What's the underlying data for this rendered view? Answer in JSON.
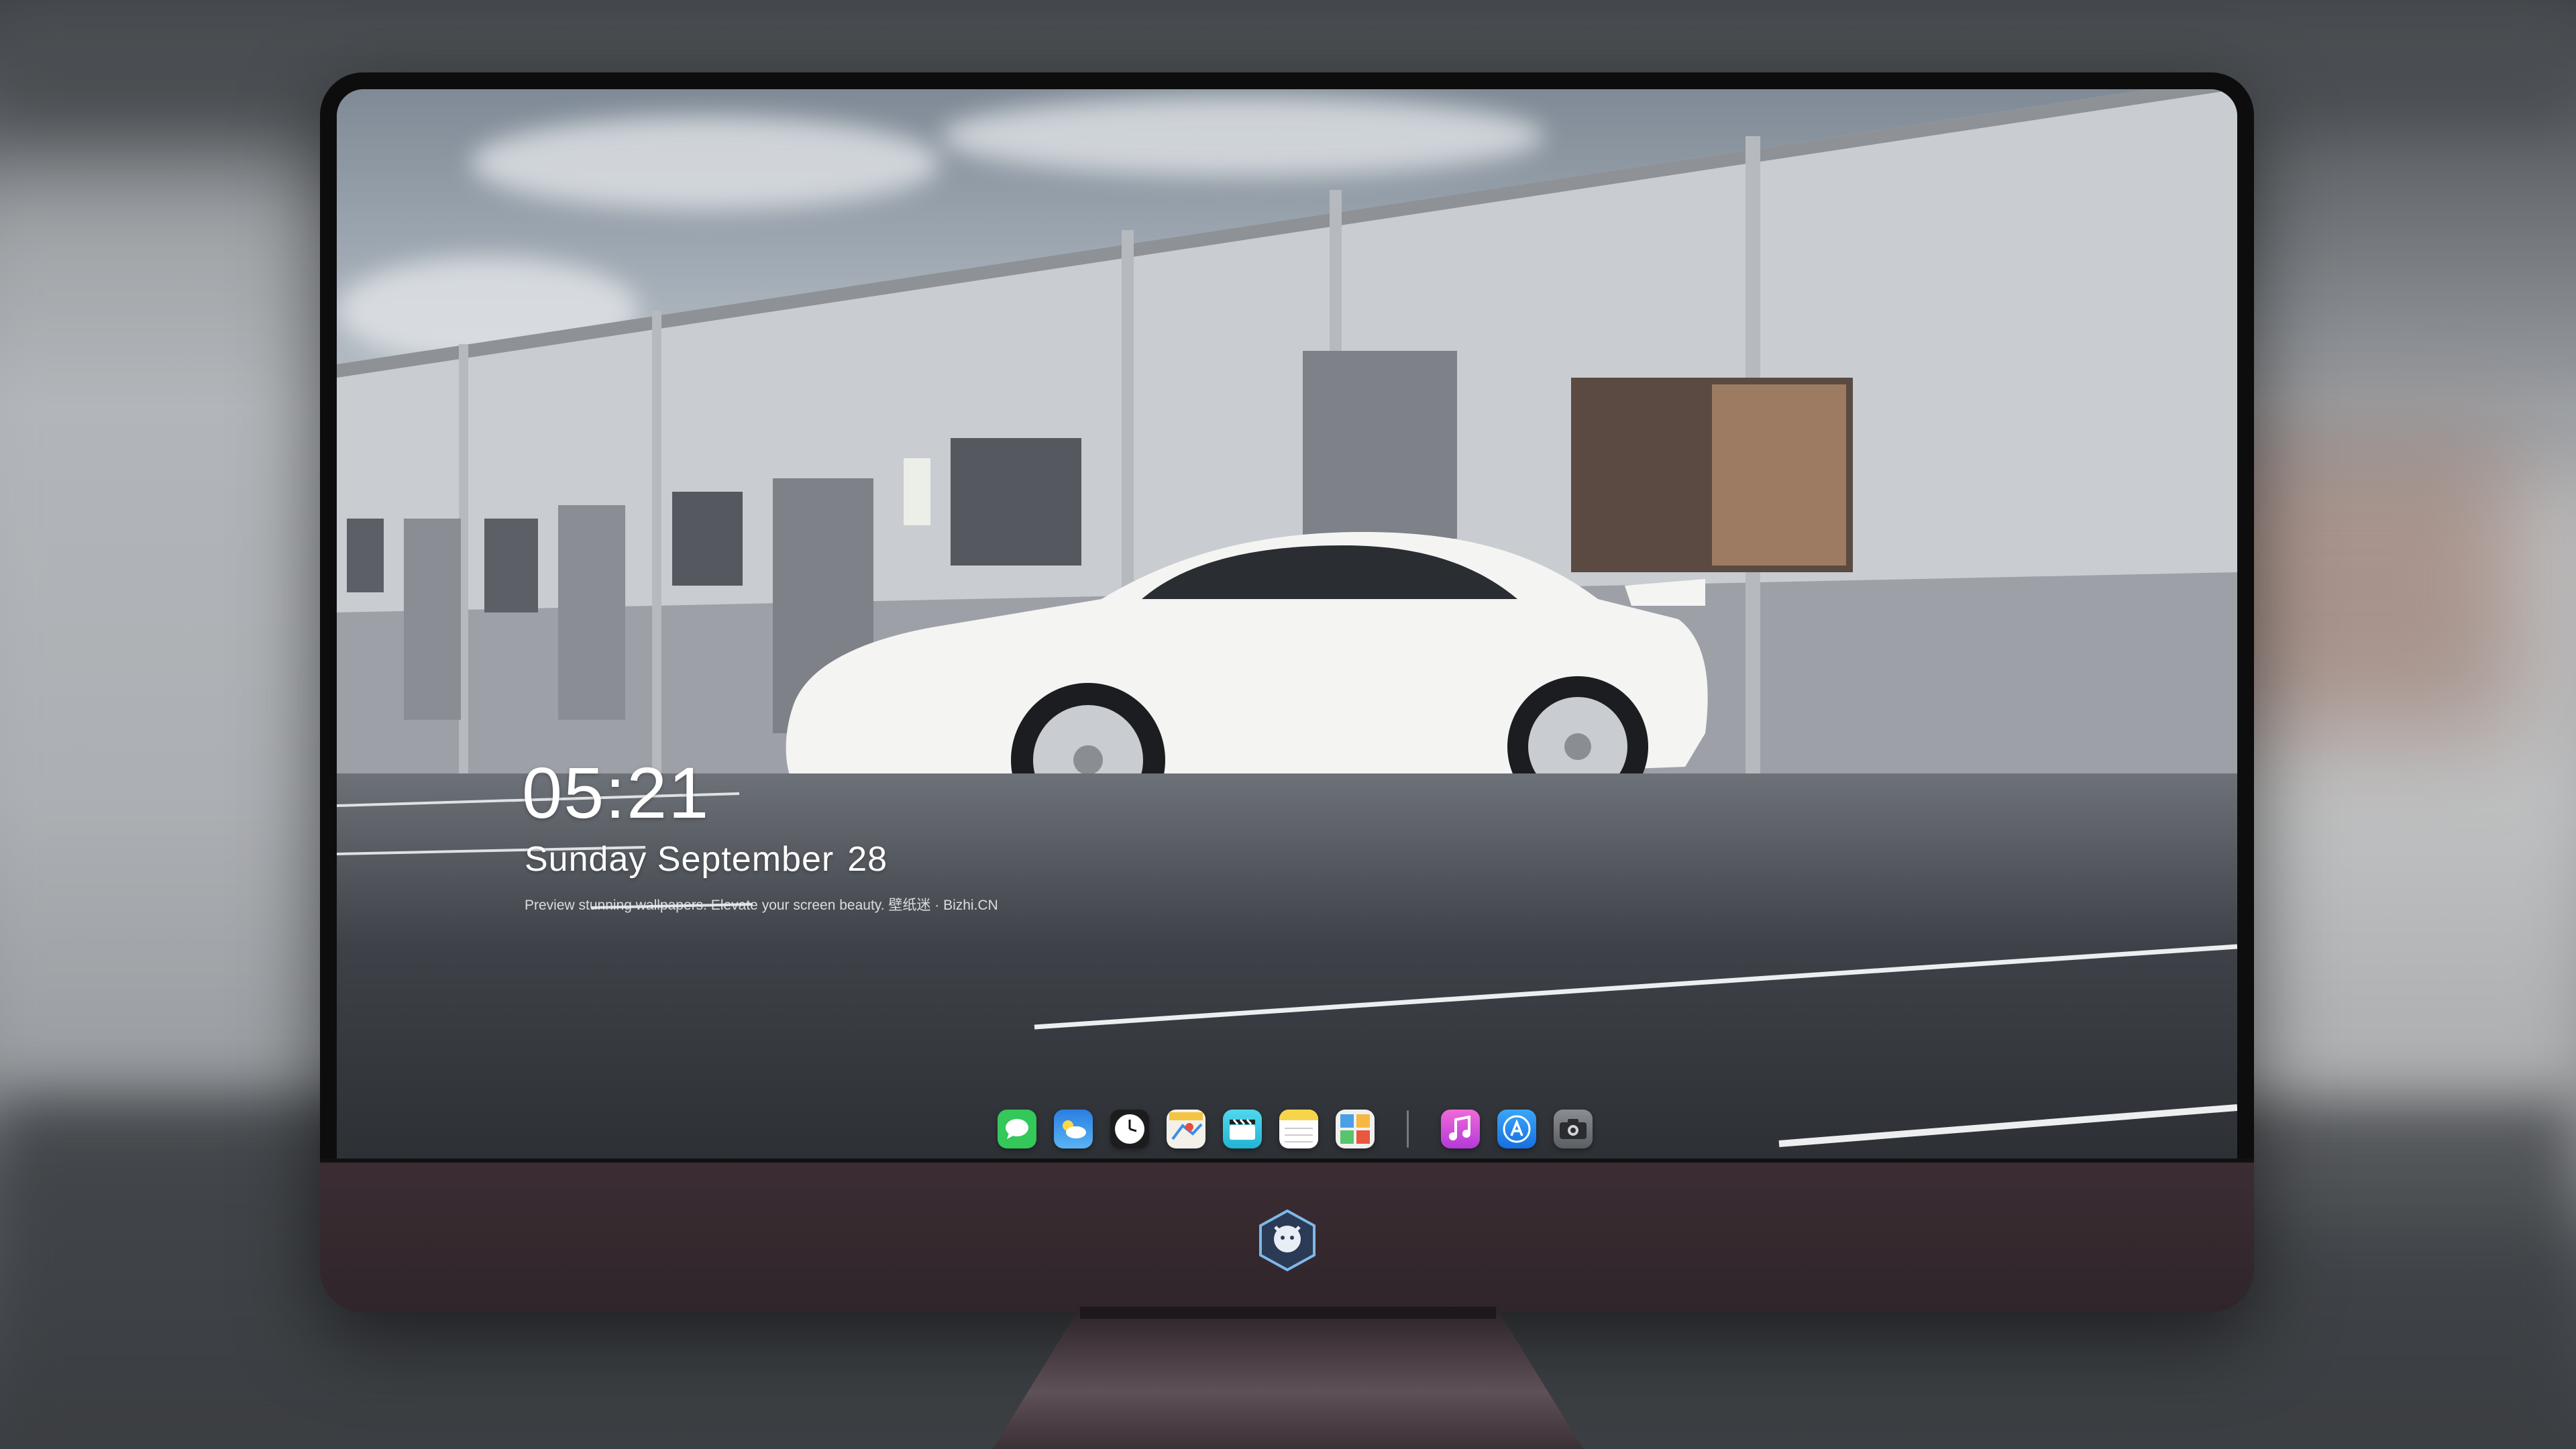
{
  "lockscreen": {
    "time": "05:21",
    "date_weekday_month": "Sunday September",
    "date_day": "28",
    "tagline": "Preview stunning wallpapers. Elevate your screen beauty. 壁纸迷 · Bizhi.CN"
  },
  "dock": {
    "apps": [
      {
        "name": "messages-icon",
        "color": "#34c759"
      },
      {
        "name": "weather-icon",
        "color": "#2f8ff0"
      },
      {
        "name": "clock-icon",
        "color": "#ffffff"
      },
      {
        "name": "maps-icon",
        "color": "#f4c542"
      },
      {
        "name": "video-icon",
        "color": "#3fd1e6"
      },
      {
        "name": "notes-icon",
        "color": "#f7d54a"
      },
      {
        "name": "photos-icon",
        "color": "#4aa0e6"
      },
      {
        "name": "music-icon",
        "color": "#d84fd2"
      },
      {
        "name": "app-store-icon",
        "color": "#1f8ef0"
      },
      {
        "name": "camera-icon",
        "color": "#6f7378"
      }
    ]
  },
  "monitor": {
    "bezel_color": "#0d0d0e",
    "chin_color": "#33272c"
  }
}
